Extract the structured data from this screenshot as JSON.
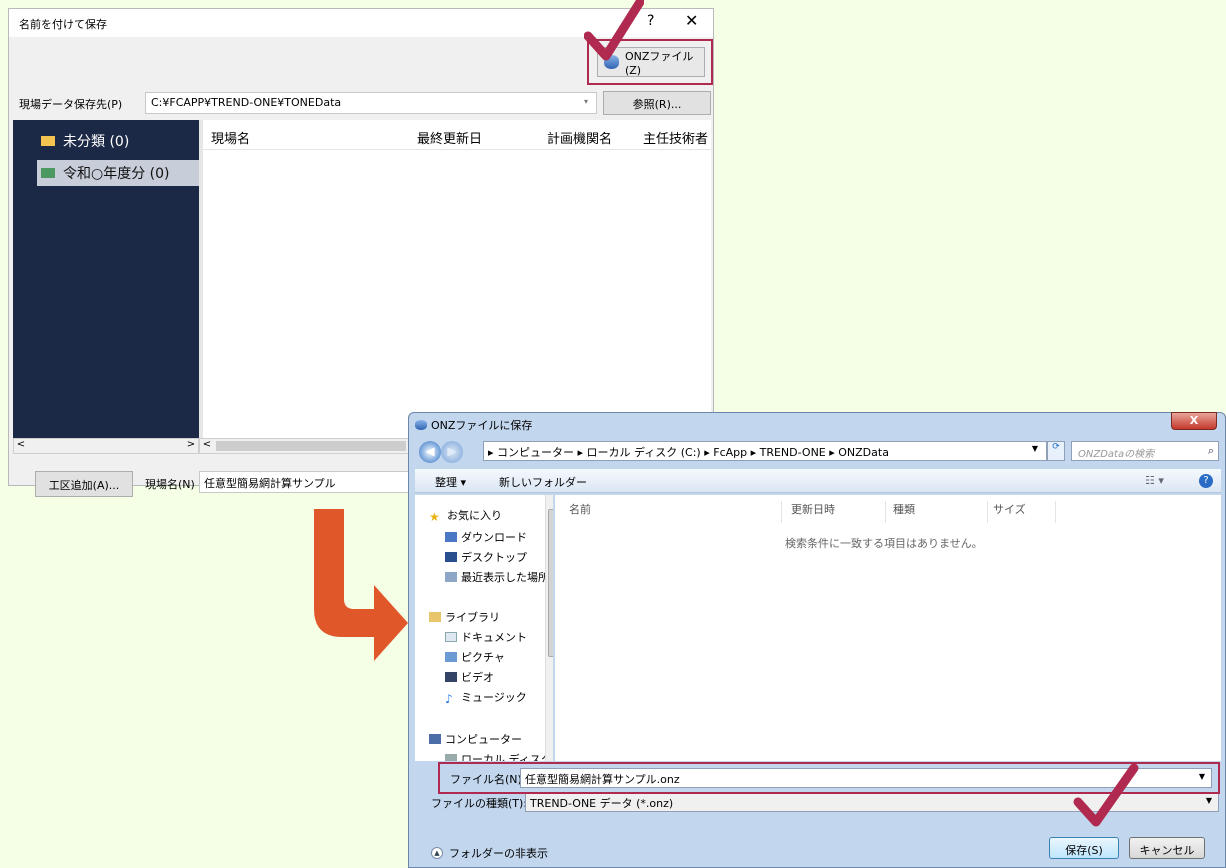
{
  "dlg1": {
    "title": "名前を付けて保存",
    "help": "?",
    "close": "✕",
    "onz_button": "ONZファイル(Z)",
    "path_label": "現場データ保存先(P)",
    "path_value": "C:¥FCAPP¥TREND-ONE¥TONEData",
    "browse_button": "参照(R)...",
    "tree": [
      {
        "label": "未分類 (0)",
        "selected": false
      },
      {
        "label": "令和○年度分 (0)",
        "selected": true
      }
    ],
    "columns": [
      "現場名",
      "最終更新日",
      "計画機関名",
      "主任技術者"
    ],
    "add_button": "工区追加(A)...",
    "site_name_label": "現場名(N)",
    "site_name_value": "任意型簡易網計算サンプル"
  },
  "dlg2": {
    "title": "ONZファイルに保存",
    "close": "X",
    "breadcrumb": "▸ コンピューター ▸ ローカル ディスク (C:) ▸ FcApp ▸ TREND-ONE ▸ ONZData",
    "search_placeholder": "ONZDataの検索",
    "toolbar": {
      "organize": "整理 ▾",
      "new_folder": "新しいフォルダー"
    },
    "nav": [
      {
        "label": "お気に入り",
        "sub": false
      },
      {
        "label": "ダウンロード",
        "sub": true
      },
      {
        "label": "デスクトップ",
        "sub": true
      },
      {
        "label": "最近表示した場所",
        "sub": true
      },
      {
        "label": "ライブラリ",
        "sub": false
      },
      {
        "label": "ドキュメント",
        "sub": true
      },
      {
        "label": "ピクチャ",
        "sub": true
      },
      {
        "label": "ビデオ",
        "sub": true
      },
      {
        "label": "ミュージック",
        "sub": true
      },
      {
        "label": "コンピューター",
        "sub": false
      },
      {
        "label": "ローカル ディスク",
        "sub": true
      }
    ],
    "file_columns": [
      "名前",
      "更新日時",
      "種類",
      "サイズ"
    ],
    "empty_message": "検索条件に一致する項目はありません。",
    "filename_label": "ファイル名(N):",
    "filename_value": "任意型簡易網計算サンプル.onz",
    "filetype_label": "ファイルの種類(T):",
    "filetype_value": "TREND-ONE データ (*.onz)",
    "hide_folders": "フォルダーの非表示",
    "save_button": "保存(S)",
    "cancel_button": "キャンセル"
  },
  "colors": {
    "highlight": "#b0294e",
    "arrow": "#e0582a",
    "tree_bg": "#1c2946"
  }
}
